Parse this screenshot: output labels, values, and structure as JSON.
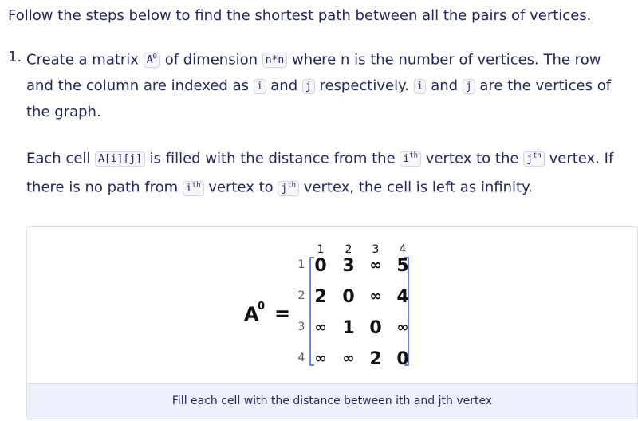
{
  "intro": "Follow the steps below to find the shortest path between all the pairs of vertices.",
  "step1": {
    "number": "1.",
    "t1": "Create a matrix",
    "c1": "A",
    "c1_sup": "0",
    "t2": "of dimension",
    "c2": "n*n",
    "t3": "where n is the number of vertices. The row and the column are indexed as",
    "c3": "i",
    "t4": "and",
    "c4": "j",
    "t5": "respectively.",
    "c5": "i",
    "t6": "and",
    "c6": "j",
    "t7": "are the vertices of the graph."
  },
  "para2": {
    "t1": "Each cell",
    "c1": "A[i][j]",
    "t2": "is filled with the distance from the",
    "c2": "i",
    "c2_sup": "th",
    "t3": "vertex to the",
    "c3": "j",
    "c3_sup": "th",
    "t4": "vertex. If there is no path from",
    "c4": "i",
    "c4_sup": "th",
    "t5": "vertex to",
    "c5": "j",
    "c5_sup": "th",
    "t6": "vertex, the cell is left as infinity."
  },
  "figure": {
    "matrix_label": "A",
    "matrix_sup": "0",
    "equals": "=",
    "col_headers": [
      "1",
      "2",
      "3",
      "4"
    ],
    "row_headers": [
      "1",
      "2",
      "3",
      "4"
    ],
    "cells": [
      [
        "0",
        "3",
        "∞",
        "5"
      ],
      [
        "2",
        "0",
        "∞",
        "4"
      ],
      [
        "∞",
        "1",
        "0",
        "∞"
      ],
      [
        "∞",
        "∞",
        "2",
        "0"
      ]
    ],
    "highlight_color": "#3a57e8",
    "caption": "Fill each cell with the distance between ith and jth vertex"
  }
}
